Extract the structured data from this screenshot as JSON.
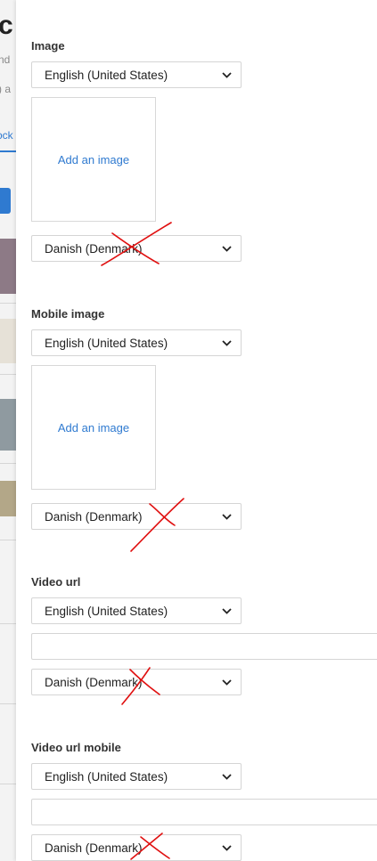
{
  "background": {
    "title_fragment": "c",
    "subtitle_fragment_1": "nd",
    "subtitle_fragment_2": ") a",
    "tab_fragment": "ock"
  },
  "annotation_color": "#e01010",
  "accent_color": "#2f7ad0",
  "sections": {
    "image": {
      "title": "Image",
      "primary_language": "English (United States)",
      "add_image_label": "Add an image",
      "secondary_language": "Danish (Denmark)"
    },
    "mobile_image": {
      "title": "Mobile image",
      "primary_language": "English (United States)",
      "add_image_label": "Add an image",
      "secondary_language": "Danish (Denmark)"
    },
    "video_url": {
      "title": "Video url",
      "primary_language": "English (United States)",
      "url_value": "",
      "secondary_language": "Danish (Denmark)"
    },
    "video_url_mobile": {
      "title": "Video url mobile",
      "primary_language": "English (United States)",
      "url_value": "",
      "secondary_language": "Danish (Denmark)"
    }
  },
  "icons": {
    "select_arrow": "chevron-down-icon",
    "annotation": "cross-mark-icon"
  }
}
